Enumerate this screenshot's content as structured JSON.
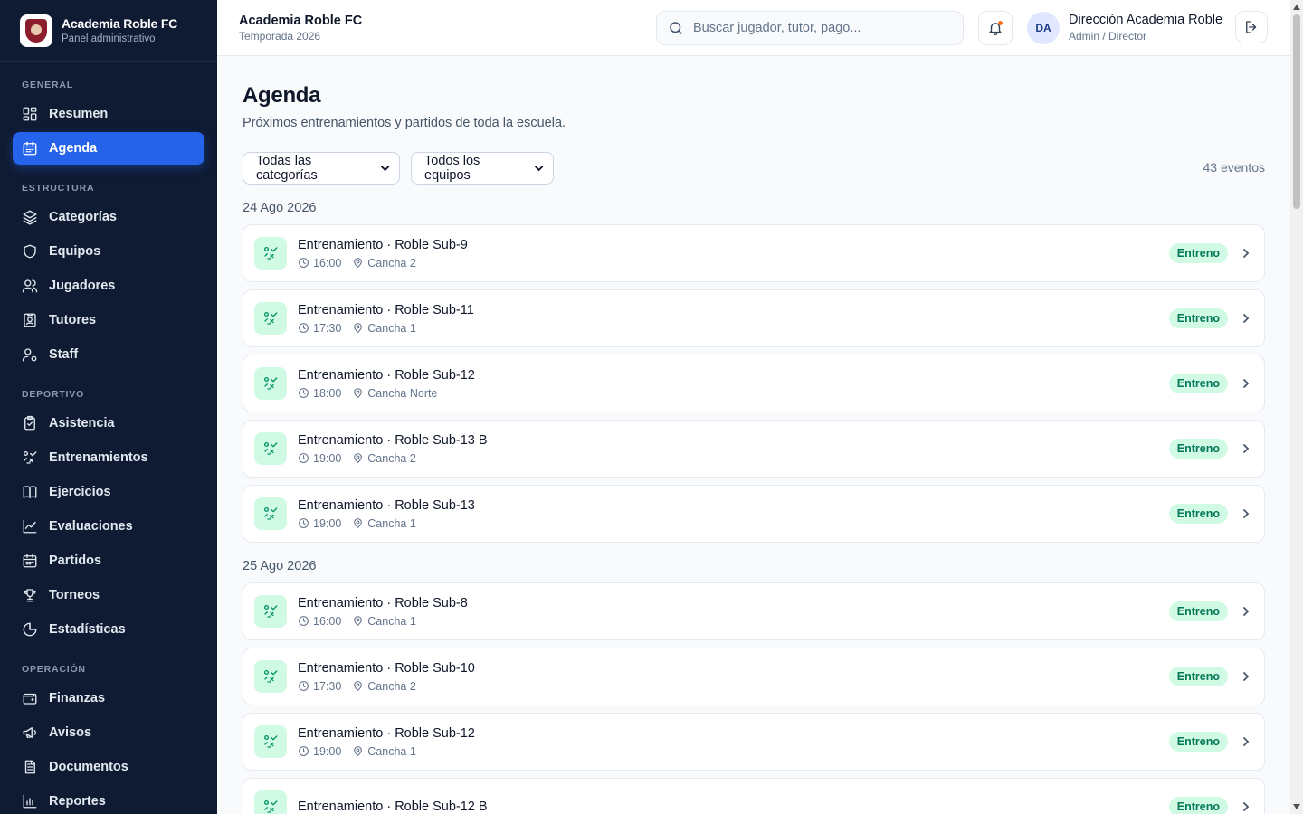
{
  "brand": {
    "name": "Academia Roble FC",
    "subtitle": "Panel administrativo"
  },
  "sidebar": {
    "sections": [
      {
        "title": "GENERAL",
        "items": [
          {
            "label": "Resumen",
            "icon": "grid-icon"
          },
          {
            "label": "Agenda",
            "icon": "calendar-icon",
            "active": true
          }
        ]
      },
      {
        "title": "ESTRUCTURA",
        "items": [
          {
            "label": "Categorías",
            "icon": "layers-icon"
          },
          {
            "label": "Equipos",
            "icon": "shield-icon"
          },
          {
            "label": "Jugadores",
            "icon": "users-icon"
          },
          {
            "label": "Tutores",
            "icon": "id-card-icon"
          },
          {
            "label": "Staff",
            "icon": "user-cog-icon"
          }
        ]
      },
      {
        "title": "DEPORTIVO",
        "items": [
          {
            "label": "Asistencia",
            "icon": "clipboard-check-icon"
          },
          {
            "label": "Entrenamientos",
            "icon": "drill-icon"
          },
          {
            "label": "Ejercicios",
            "icon": "book-icon"
          },
          {
            "label": "Evaluaciones",
            "icon": "line-chart-icon"
          },
          {
            "label": "Partidos",
            "icon": "calendar-icon"
          },
          {
            "label": "Torneos",
            "icon": "trophy-icon"
          },
          {
            "label": "Estadísticas",
            "icon": "pie-chart-icon"
          }
        ]
      },
      {
        "title": "OPERACIÓN",
        "items": [
          {
            "label": "Finanzas",
            "icon": "wallet-icon"
          },
          {
            "label": "Avisos",
            "icon": "megaphone-icon"
          },
          {
            "label": "Documentos",
            "icon": "file-icon"
          },
          {
            "label": "Reportes",
            "icon": "bar-chart-icon"
          }
        ]
      }
    ]
  },
  "topbar": {
    "title": "Academia Roble FC",
    "season": "Temporada 2026",
    "search_placeholder": "Buscar jugador, tutor, pago...",
    "avatar_initials": "DA",
    "user_name": "Dirección Academia Roble",
    "user_role": "Admin / Director"
  },
  "page": {
    "title": "Agenda",
    "subtitle": "Próximos entrenamientos y partidos de toda la escuela.",
    "filter_category": "Todas las categorías",
    "filter_team": "Todos los equipos",
    "event_count": "43 eventos"
  },
  "days": [
    {
      "date": "24 Ago 2026",
      "events": [
        {
          "title": "Entrenamiento · Roble Sub-9",
          "time": "16:00",
          "place": "Cancha 2",
          "badge": "Entreno"
        },
        {
          "title": "Entrenamiento · Roble Sub-11",
          "time": "17:30",
          "place": "Cancha 1",
          "badge": "Entreno"
        },
        {
          "title": "Entrenamiento · Roble Sub-12",
          "time": "18:00",
          "place": "Cancha Norte",
          "badge": "Entreno"
        },
        {
          "title": "Entrenamiento · Roble Sub-13 B",
          "time": "19:00",
          "place": "Cancha 2",
          "badge": "Entreno"
        },
        {
          "title": "Entrenamiento · Roble Sub-13",
          "time": "19:00",
          "place": "Cancha 1",
          "badge": "Entreno"
        }
      ]
    },
    {
      "date": "25 Ago 2026",
      "events": [
        {
          "title": "Entrenamiento · Roble Sub-8",
          "time": "16:00",
          "place": "Cancha 1",
          "badge": "Entreno"
        },
        {
          "title": "Entrenamiento · Roble Sub-10",
          "time": "17:30",
          "place": "Cancha 2",
          "badge": "Entreno"
        },
        {
          "title": "Entrenamiento · Roble Sub-12",
          "time": "19:00",
          "place": "Cancha 1",
          "badge": "Entreno"
        },
        {
          "title": "Entrenamiento · Roble Sub-12 B",
          "time": "",
          "place": "",
          "badge": "Entreno"
        }
      ]
    }
  ],
  "colors": {
    "sidebar_bg": "#0f1b33",
    "accent": "#2563eb",
    "badge_bg": "#d1fae5",
    "badge_text": "#047857"
  }
}
